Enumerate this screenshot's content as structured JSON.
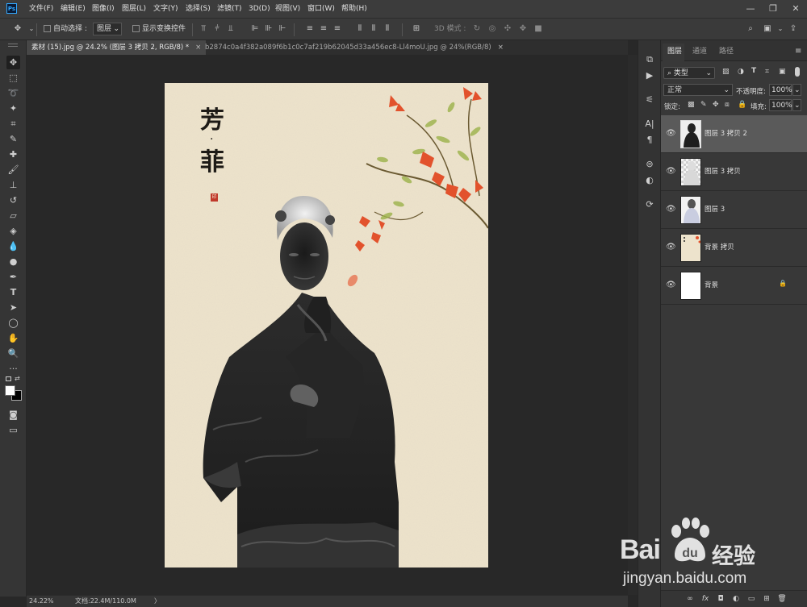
{
  "app": {
    "logo_text": "Ps",
    "menu": [
      "文件(F)",
      "编辑(E)",
      "图像(I)",
      "图层(L)",
      "文字(Y)",
      "选择(S)",
      "滤镜(T)",
      "3D(D)",
      "视图(V)",
      "窗口(W)",
      "帮助(H)"
    ],
    "window_controls": {
      "minimize": "—",
      "restore": "❐",
      "close": "✕"
    }
  },
  "options": {
    "auto_select_label": "自动选择 :",
    "auto_select_value": "图层",
    "show_transform_label": "显示变换控件",
    "mode_3d_label": "3D 模式 :"
  },
  "tabs": [
    {
      "label": "素材 (15).jpg @ 24.2% (图层 3 拷贝 2, RGB/8) *",
      "close": "×"
    },
    {
      "label": "b2874c0a4f382a089f6b1c0c7af219b62045d33a456ec8-Ll4moU.jpg @ 24%(RGB/8)",
      "close": "×"
    }
  ],
  "document": {
    "title_line1": "芳",
    "title_dot": "·",
    "title_line2": "菲",
    "seal_text": "印"
  },
  "status": {
    "zoom": "24.22%",
    "doc_info": "文档:22.4M/110.0M",
    "arrow": "〉"
  },
  "panel": {
    "tabs": [
      "图层",
      "通道",
      "路径"
    ],
    "filter_kind": "类型",
    "blend_mode": "正常",
    "opacity_label": "不透明度:",
    "opacity_value": "100%",
    "lock_label": "锁定:",
    "fill_label": "填充:",
    "fill_value": "100%",
    "layers": [
      {
        "name": "图层 3 拷贝 2",
        "selected": true,
        "visible": true,
        "locked": false
      },
      {
        "name": "图层 3 拷贝",
        "selected": false,
        "visible": true,
        "locked": false
      },
      {
        "name": "图层 3",
        "selected": false,
        "visible": true,
        "locked": false
      },
      {
        "name": "背景 拷贝",
        "selected": false,
        "visible": true,
        "locked": false
      },
      {
        "name": "背景",
        "selected": false,
        "visible": true,
        "locked": true
      }
    ],
    "bottom_icons": [
      "link-icon",
      "fx-icon",
      "mask-icon",
      "adjustment-icon",
      "folder-icon",
      "new-layer-icon",
      "trash-icon"
    ]
  },
  "watermark": {
    "brand_left": "Bai",
    "brand_right": "经验",
    "url": "jingyan.baidu.com"
  },
  "colors": {
    "accent": "#31a8ff",
    "paper": "#ede3cc",
    "flower": "#e2522c",
    "selected_layer": "#5a5a5a"
  }
}
